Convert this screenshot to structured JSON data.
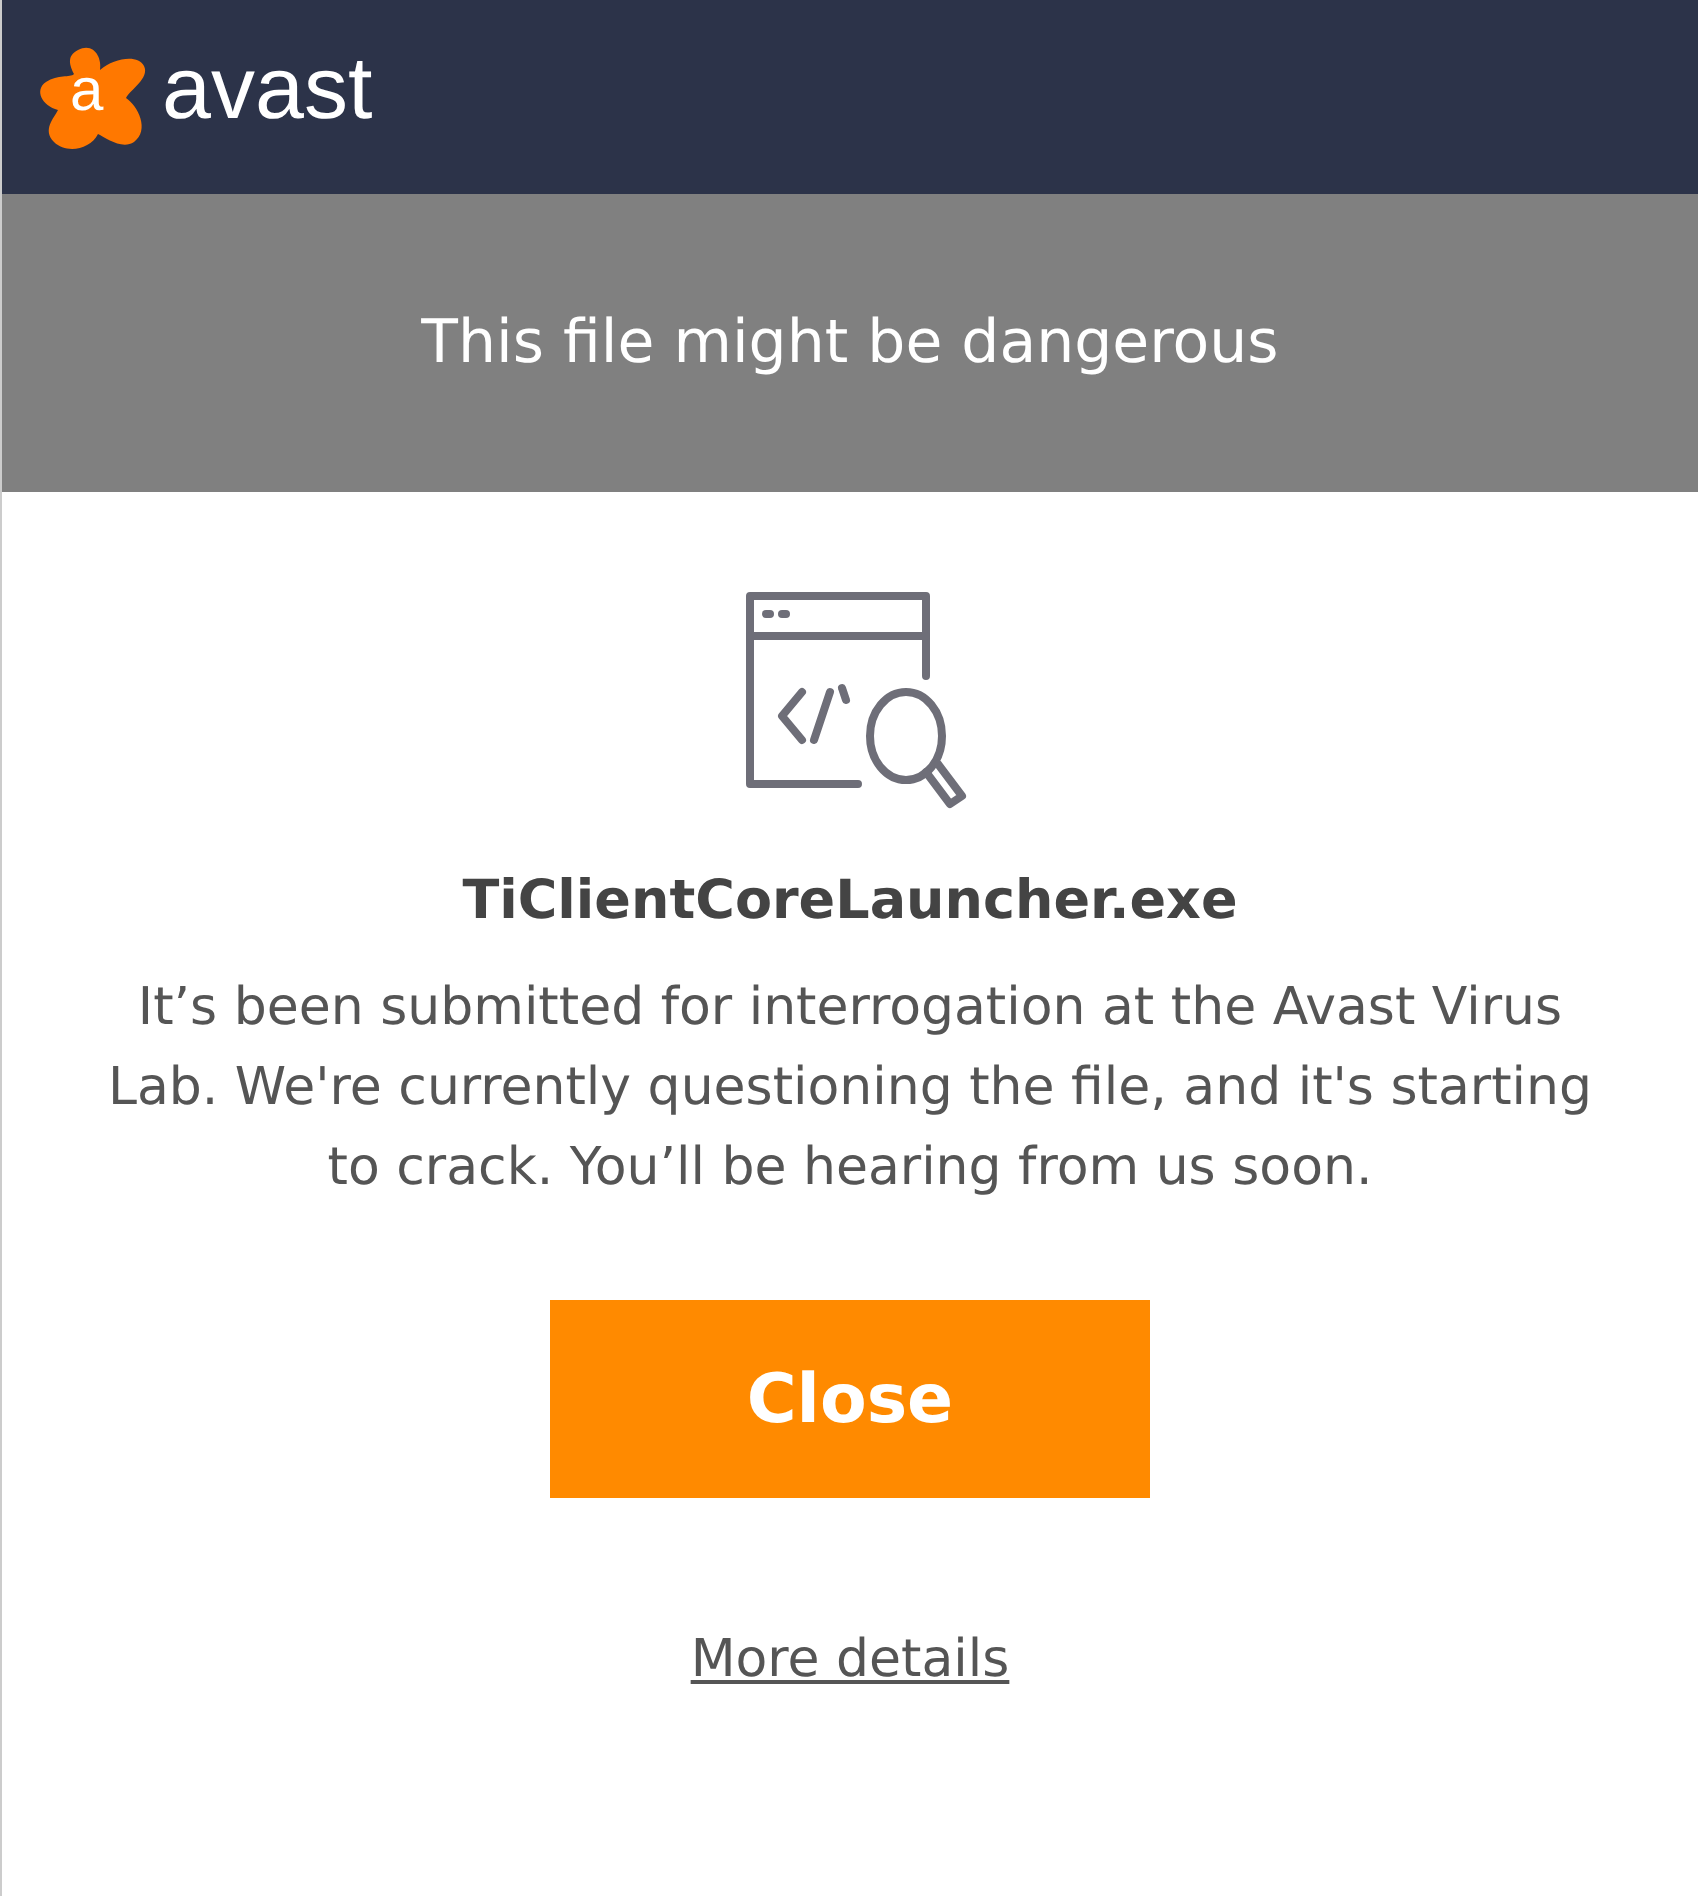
{
  "header": {
    "logo_letter": "a",
    "brand": "avast"
  },
  "banner": {
    "title": "This file might be dangerous"
  },
  "file_name": "TiClientCoreLauncher.exe",
  "message": "It’s been submitted for interrogation at the Avast Virus Lab. We're currently questioning the file, and it's starting to crack. You’ll be hearing from us soon.",
  "buttons": [
    {
      "label": "Close",
      "kind": "primary"
    }
  ],
  "link": "More details"
}
